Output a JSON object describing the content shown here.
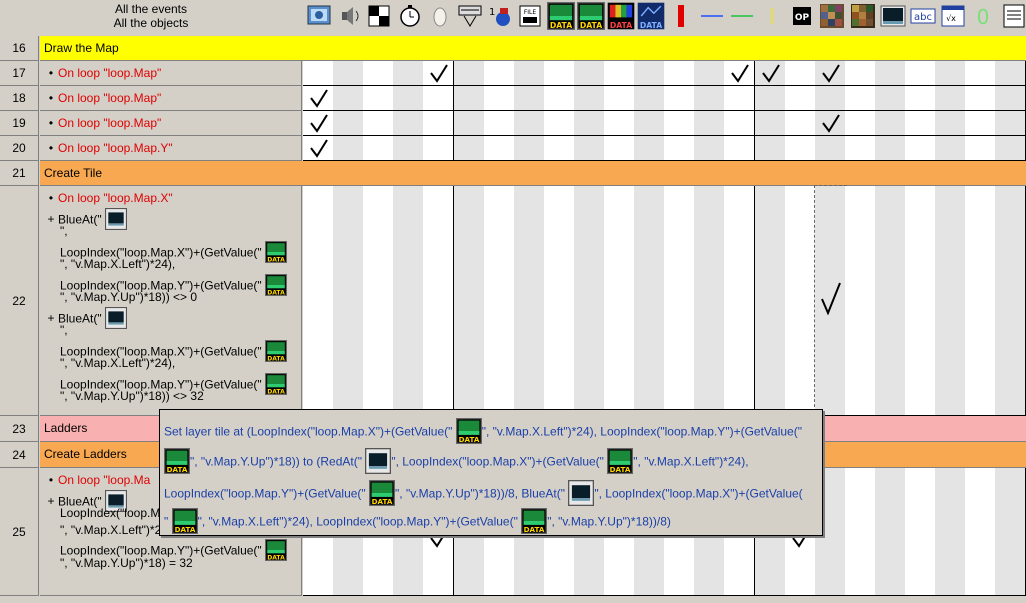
{
  "header": {
    "line1": "All the events",
    "line2": "All the objects"
  },
  "object_icons": [
    "storyboard-icon",
    "sound-icon",
    "special-icon",
    "timer-icon",
    "create-object-icon",
    "mouse-keyboard-icon",
    "player-icon",
    "file-icon",
    "array-data-icon",
    "layer-data-icon",
    "color-data-icon",
    "map-data-icon",
    "red-bar-icon",
    "blue-line-icon",
    "green-line-icon",
    "yellow-line-icon",
    "op-icon",
    "tileset-a-icon",
    "tileset-b-icon",
    "backdrop-icon",
    "string-abc-icon",
    "formula-icon",
    "counter-icon",
    "edit-box-icon"
  ],
  "rows": [
    {
      "num": "16",
      "type": "group",
      "title": "Draw the Map",
      "color": "#ffff00"
    },
    {
      "num": "17",
      "type": "event",
      "lines": [
        "On loop \"loop.Map\""
      ]
    },
    {
      "num": "18",
      "type": "event",
      "lines": [
        "On loop \"loop.Map\""
      ]
    },
    {
      "num": "19",
      "type": "event",
      "lines": [
        "On loop \"loop.Map\""
      ]
    },
    {
      "num": "20",
      "type": "event",
      "lines": [
        "On loop \"loop.Map.Y\""
      ]
    },
    {
      "num": "21",
      "type": "group",
      "title": "Create Tile",
      "color": "#f8a850"
    },
    {
      "num": "22",
      "type": "event",
      "lines": [
        "On loop \"loop.Map.X\"",
        "BlueAt(\" ",
        "\",",
        "LoopIndex(\"loop.Map.X\")+(GetValue(\" ",
        "\", \"v.Map.X.Left\")*24),",
        "LoopIndex(\"loop.Map.Y\")+(GetValue(\" ",
        "\", \"v.Map.Y.Up\")*18)) <> 0",
        "BlueAt(\" ",
        "\",",
        "LoopIndex(\"loop.Map.X\")+(GetValue(\" ",
        "\", \"v.Map.X.Left\")*24),",
        "LoopIndex(\"loop.Map.Y\")+(GetValue(\" ",
        "\", \"v.Map.Y.Up\")*18)) <> 32"
      ]
    },
    {
      "num": "23",
      "type": "group",
      "title": "Ladders",
      "color": "#f8b0b0"
    },
    {
      "num": "24",
      "type": "group",
      "title": "Create Ladders",
      "color": "#f8a850"
    },
    {
      "num": "25",
      "type": "event",
      "lines": [
        "On loop \"loop.Ma",
        "BlueAt(\" ",
        "LoopIndex(\"loop.M",
        "\", \"v.Map.X.Left\")*24),",
        "LoopIndex(\"loop.Map.Y\")+(GetValue(\" ",
        "\", \"v.Map.Y.Up\")*18) = 32"
      ]
    }
  ],
  "tooltip": {
    "l1a": "Set layer tile at (LoopIndex(\"loop.Map.X\")+(GetValue(\" ",
    "l1b": "\", \"v.Map.X.Left\")*24), LoopIndex(\"loop.Map.Y\")+(GetValue(\"",
    "l2a": "\", \"v.Map.Y.Up\")*18)) to (RedAt(\" ",
    "l2b": "\", LoopIndex(\"loop.Map.X\")+(GetValue(\" ",
    "l2c": "\", \"v.Map.X.Left\")*24),",
    "l3a": "LoopIndex(\"loop.Map.Y\")+(GetValue(\" ",
    "l3b": "\", \"v.Map.Y.Up\")*18))/8, BlueAt(\" ",
    "l3c": "\", LoopIndex(\"loop.Map.X\")+(GetValue(",
    "l4a": "\" ",
    "l4b": "\", \"v.Map.X.Left\")*24), LoopIndex(\"loop.Map.Y\")+(GetValue(\" ",
    "l4c": "\", \"v.Map.Y.Up\")*18))/8)"
  },
  "colors": {
    "background": "#d4d0c8",
    "text_red": "#e00000",
    "tooltip_text": "#1a3fa8"
  }
}
